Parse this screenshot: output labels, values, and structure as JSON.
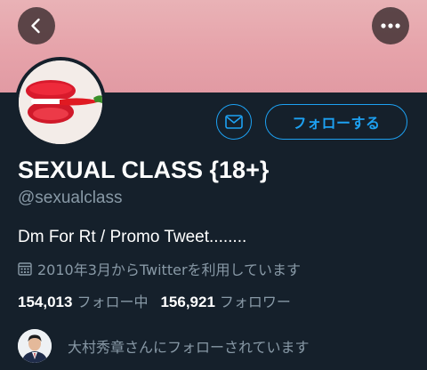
{
  "header": {
    "back_icon": "chevron-left-icon",
    "more_icon": "ellipsis-icon",
    "banner_color": "#e6a3aa"
  },
  "profile": {
    "display_name": "SEXUAL CLASS {18+}",
    "handle": "@sexualclass",
    "bio": "Dm For Rt / Promo Tweet........",
    "joined": "2010年3月からTwitterを利用しています",
    "joined_icon": "calendar-icon"
  },
  "actions": {
    "message_icon": "envelope-icon",
    "follow_label": "フォローする",
    "accent_color": "#1da1f2"
  },
  "stats": {
    "following_count": "154,013",
    "following_label": "フォロー中",
    "followers_count": "156,921",
    "followers_label": "フォロワー"
  },
  "followed_by": {
    "text": "大村秀章さんにフォローされています"
  }
}
